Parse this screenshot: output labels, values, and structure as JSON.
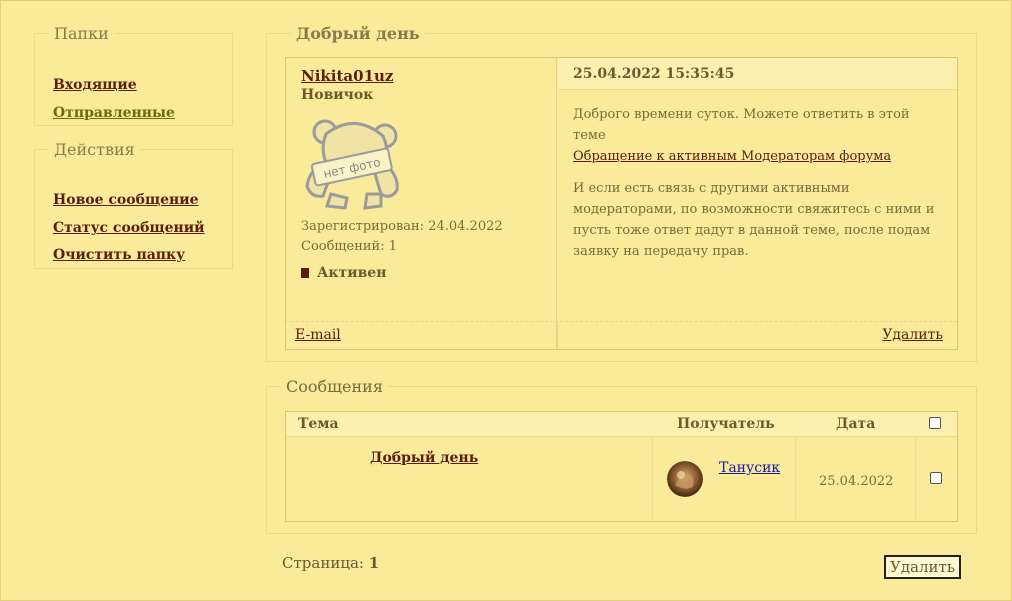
{
  "sidebar": {
    "folders_title": "Папки",
    "folders": [
      {
        "label": "Входящие"
      },
      {
        "label": "Отправленные"
      }
    ],
    "actions_title": "Действия",
    "actions": [
      {
        "label": "Новое сообщение"
      },
      {
        "label": "Статус сообщений"
      },
      {
        "label": "Очистить папку"
      }
    ]
  },
  "message": {
    "subject": "Добрый день",
    "author": {
      "username": "Nikita01uz",
      "rank": "Новичок",
      "avatar_placeholder": "нет фото",
      "registered": "Зарегистрирован: 24.04.2022",
      "posts": "Сообщений: 1",
      "status": "Активен"
    },
    "datetime": "25.04.2022 15:35:45",
    "body_line1": "Доброго времени суток. Можете ответить в этой теме",
    "body_link": "Обращение к активным Модераторам форума",
    "body_paragraph2": "И если есть связь с другими активными модераторами, по возможности свяжитесь с ними и пусть тоже ответ дадут в данной теме, после подам заявку на передачу прав.",
    "email_label": "E-mail",
    "delete_label": "Удалить"
  },
  "messages": {
    "title": "Сообщения",
    "columns": {
      "topic": "Тема",
      "recipient": "Получатель",
      "date": "Дата"
    },
    "rows": [
      {
        "topic": "Добрый день",
        "recipient": "Танусик",
        "date": "25.04.2022"
      }
    ]
  },
  "pagination": {
    "label": "Страница:",
    "current": "1"
  },
  "delete_button": "Удалить"
}
